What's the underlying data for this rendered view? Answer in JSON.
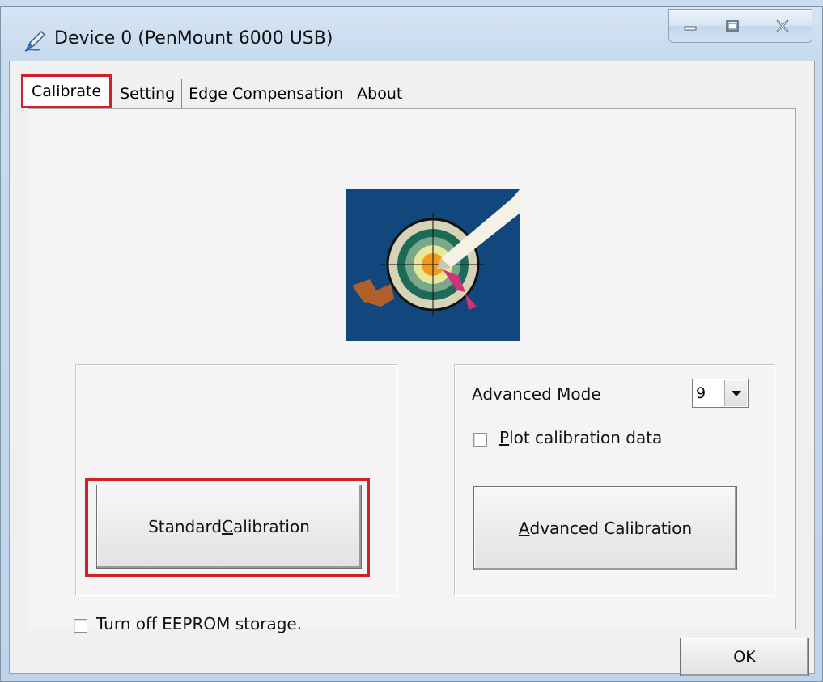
{
  "window": {
    "title": "Device 0 (PenMount 6000 USB)"
  },
  "caption_buttons": {
    "minimize_icon": "minimize-icon",
    "maximize_icon": "maximize-icon",
    "close_icon": "close-icon"
  },
  "tabs": [
    {
      "label": "Calibrate",
      "active": true
    },
    {
      "label": "Setting",
      "active": false
    },
    {
      "label": "Edge Compensation",
      "active": false
    },
    {
      "label": "About",
      "active": false
    }
  ],
  "calibrate": {
    "logo_icon": "calibration-target-icon",
    "standard_button": {
      "pre": "Standard ",
      "accel": "C",
      "post": "alibration"
    },
    "advanced_mode_label": "Advanced Mode",
    "advanced_mode_value": "9",
    "plot_checkbox": {
      "accel": "P",
      "rest": "lot calibration data",
      "checked": false
    },
    "advanced_button": {
      "accel": "A",
      "rest": "dvanced Calibration"
    },
    "eeprom_checkbox": {
      "label": "Turn off EEPROM storage.",
      "checked": false
    }
  },
  "footer": {
    "ok_label": "OK"
  },
  "highlight_color": "#d0202a"
}
